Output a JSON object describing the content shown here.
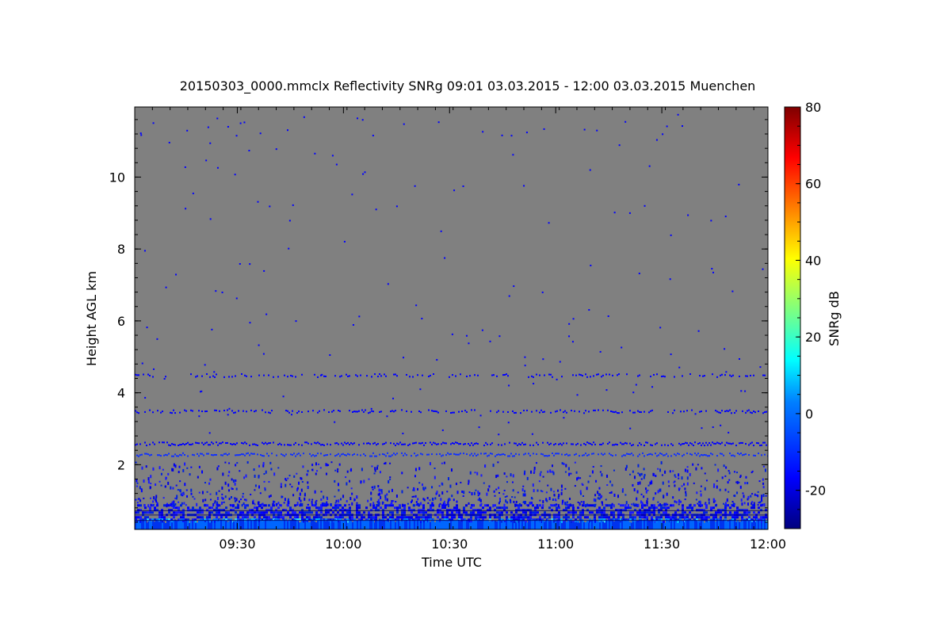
{
  "chart_data": {
    "type": "heatmap",
    "title": "20150303_0000.mmclx Reflectivity SNRg   09:01 03.03.2015 - 12:00 03.03.2015 Muenchen",
    "xlabel": "Time UTC",
    "ylabel": "Height AGL km",
    "colorbar_label": "SNRg dB",
    "x_range": [
      "09:01",
      "12:00"
    ],
    "x_ticks": [
      "09:30",
      "10:00",
      "10:30",
      "11:00",
      "11:30",
      "12:00"
    ],
    "y_range": [
      0.2,
      11.95
    ],
    "y_ticks": [
      2,
      4,
      6,
      8,
      10
    ],
    "colorbar_range": [
      -30,
      80
    ],
    "colorbar_ticks": [
      -20,
      0,
      20,
      40,
      60,
      80
    ],
    "background_color": "#808080",
    "colormap": [
      "#00007f",
      "#0000ff",
      "#007fff",
      "#00ffff",
      "#7fff7f",
      "#ffff00",
      "#ff7f00",
      "#ff0000",
      "#7f0000"
    ],
    "layers": [
      {
        "height_km": 4.5,
        "snr_db": -22
      },
      {
        "height_km": 3.5,
        "snr_db": -22
      },
      {
        "height_km": 2.6,
        "snr_db": -20
      },
      {
        "height_km": 2.3,
        "snr_db": -15
      },
      {
        "height_km": 0.6,
        "snr_db": -10
      }
    ]
  }
}
